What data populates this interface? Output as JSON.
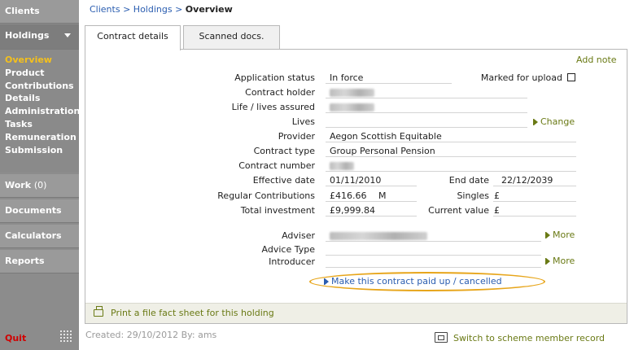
{
  "sidebar": {
    "clients": "Clients",
    "holdings": "Holdings",
    "sub_items": [
      {
        "label": "Overview"
      },
      {
        "label": "Product"
      },
      {
        "label": "Contributions"
      },
      {
        "label": "Details"
      },
      {
        "label": "Administration"
      },
      {
        "label": "Tasks"
      },
      {
        "label": "Remuneration"
      },
      {
        "label": "Submission"
      }
    ],
    "work": "Work",
    "work_count": "(0)",
    "documents": "Documents",
    "calculators": "Calculators",
    "reports": "Reports",
    "quit": "Quit"
  },
  "breadcrumb": {
    "clients": "Clients",
    "holdings": "Holdings",
    "current": "Overview",
    "separator": ">"
  },
  "tabs": [
    {
      "label": "Contract details"
    },
    {
      "label": "Scanned docs."
    }
  ],
  "panel": {
    "add_note": "Add note",
    "application_status_label": "Application status",
    "application_status": "In force",
    "marked_for_upload_label": "Marked for upload",
    "contract_holder_label": "Contract holder",
    "life_assured_label": "Life / lives assured",
    "lives_label": "Lives",
    "change_link": "Change",
    "provider_label": "Provider",
    "provider": "Aegon Scottish Equitable",
    "contract_type_label": "Contract type",
    "contract_type": "Group Personal Pension",
    "contract_number_label": "Contract number",
    "effective_date_label": "Effective date",
    "effective_date": "01/11/2010",
    "end_date_label": "End date",
    "end_date": "22/12/2039",
    "regular_contributions_label": "Regular Contributions",
    "regular_contributions": "£416.66",
    "regular_frequency": "M",
    "singles_label": "Singles",
    "singles": "£",
    "total_investment_label": "Total investment",
    "total_investment": "£9,999.84",
    "current_value_label": "Current value",
    "current_value": "£",
    "adviser_label": "Adviser",
    "advice_type_label": "Advice Type",
    "introducer_label": "Introducer",
    "more_link": "More",
    "paid_up_link": "Make this contract paid up / cancelled",
    "print_link": "Print a file fact sheet for this holding"
  },
  "footer": {
    "created": "Created: 29/10/2012 By: ams",
    "switch_link": "Switch to scheme member record"
  },
  "colors": {
    "sidebar_bg": "#8c8c8c",
    "active_nav": "#f4c01c",
    "link_blue": "#2a5db0",
    "link_olive": "#6a7a15",
    "highlight_ring": "#e7a51a",
    "quit_red": "#d10000"
  }
}
